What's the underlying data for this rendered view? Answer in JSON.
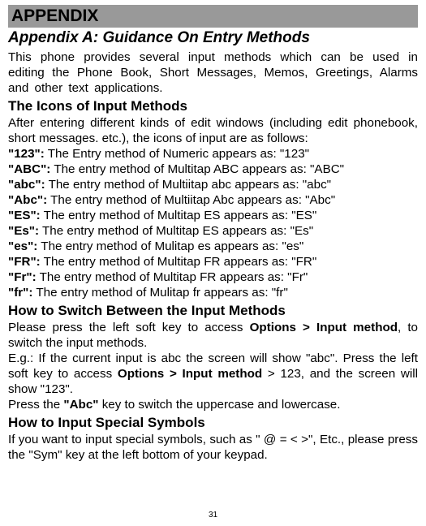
{
  "header": {
    "title": "APPENDIX"
  },
  "subheading": "Appendix A: Guidance On Entry Methods",
  "intro": "This phone provides several input methods which can be used in editing the Phone Book, Short Messages, Memos, Greetings, Alarms and other text applications.",
  "icons": {
    "heading": "The Icons of Input Methods",
    "lead": "After entering different kinds of edit windows (including edit phonebook, short messages. etc.), the icons of input are as follows:",
    "items": [
      {
        "label": "\"123\":",
        "desc": " The Entry method of Numeric appears as: \"123\""
      },
      {
        "label": "\"ABC\":",
        "desc": " The entry method of Multitap ABC appears as: \"ABC\""
      },
      {
        "label": "\"abc\":",
        "desc": " The    entry method of Multiitap abc appears as: \"abc\""
      },
      {
        "label": "\"Abc\":",
        "desc": " The entry method of Multiitap Abc appears as: \"Abc\""
      },
      {
        "label": "\"ES\":",
        "desc": " The entry method of Multitap ES appears as: \"ES\""
      },
      {
        "label": "\"Es\":",
        "desc": " The entry method of Multitap ES appears as: \"Es\""
      },
      {
        "label": "\"es\":",
        "desc": " The    entry method of Mulitap es appears as: \"es\""
      },
      {
        "label": "\"FR\":",
        "desc": " The entry method of Multitap FR appears as: \"FR\""
      },
      {
        "label": "\"Fr\":",
        "desc": " The entry method of Multitap FR appears as: \"Fr\""
      },
      {
        "label": "\"fr\":",
        "desc": " The    entry method of Mulitap fr appears as: \"fr\""
      }
    ]
  },
  "switch": {
    "heading": "How to Switch Between the Input Methods",
    "p1a": "Please press the left soft key to access ",
    "p1b": "Options > Input method",
    "p1c": ", to switch the input methods.",
    "p2a": "E.g.: If the current input is abc the screen will show \"abc\". Press the left soft key to access ",
    "p2b": "Options > Input method",
    "p2c": " > 123, and the screen will show \"123\".",
    "p3a": "Press the ",
    "p3b": "\"Abc\"",
    "p3c": " key to switch the uppercase and lowercase."
  },
  "symbols": {
    "heading": "How to Input Special Symbols",
    "p": "If you want to input special symbols, such as \" @ = < >\", Etc., please press the \"Sym\" key at the left bottom of your keypad."
  },
  "page": "31"
}
